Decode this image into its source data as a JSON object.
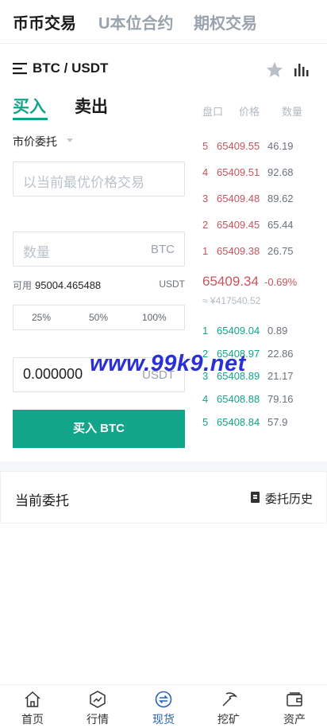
{
  "top_tabs": [
    {
      "label": "币币交易",
      "active": true
    },
    {
      "label": "U本位合约",
      "active": false
    },
    {
      "label": "期权交易",
      "active": false
    }
  ],
  "pair": {
    "title": "BTC / USDT"
  },
  "trade": {
    "buy_tab": "买入",
    "sell_tab": "卖出",
    "order_type": "市价委托",
    "price_placeholder": "以当前最优价格交易",
    "amount_placeholder": "数量",
    "amount_unit": "BTC",
    "available_label": "可用",
    "available_value": "95004.465488",
    "available_unit": "USDT",
    "percents": [
      "25%",
      "50%",
      "100%"
    ],
    "total_value": "0.000000",
    "total_unit": "USDT",
    "buy_button": "买入 BTC"
  },
  "orderbook": {
    "headers": {
      "depth": "盘口",
      "price": "价格",
      "qty": "数量"
    },
    "asks": [
      {
        "idx": "5",
        "price": "65409.55",
        "qty": "46.19"
      },
      {
        "idx": "4",
        "price": "65409.51",
        "qty": "92.68"
      },
      {
        "idx": "3",
        "price": "65409.48",
        "qty": "89.62"
      },
      {
        "idx": "2",
        "price": "65409.45",
        "qty": "65.44"
      },
      {
        "idx": "1",
        "price": "65409.38",
        "qty": "26.75"
      }
    ],
    "last_price": "65409.34",
    "last_change": "-0.69%",
    "last_cny": "≈ ¥417540.52",
    "bids": [
      {
        "idx": "1",
        "price": "65409.04",
        "qty": "0.89"
      },
      {
        "idx": "2",
        "price": "65408.97",
        "qty": "22.86"
      },
      {
        "idx": "3",
        "price": "65408.89",
        "qty": "21.17"
      },
      {
        "idx": "4",
        "price": "65408.88",
        "qty": "79.16"
      },
      {
        "idx": "5",
        "price": "65408.84",
        "qty": "57.9"
      }
    ]
  },
  "watermark": "www.99k9.net",
  "orders": {
    "title": "当前委托",
    "history_link": "委托历史"
  },
  "bottom_nav": [
    {
      "label": "首页",
      "icon": "home-icon",
      "active": false
    },
    {
      "label": "行情",
      "icon": "market-icon",
      "active": false
    },
    {
      "label": "现货",
      "icon": "spot-exchange-icon",
      "active": true
    },
    {
      "label": "挖矿",
      "icon": "mining-pickaxe-icon",
      "active": false
    },
    {
      "label": "资产",
      "icon": "wallet-icon",
      "active": false
    }
  ],
  "colors": {
    "accent": "#13a589",
    "down": "#c8545f",
    "nav_active": "#2563b8",
    "watermark": "#2a2fd6"
  }
}
